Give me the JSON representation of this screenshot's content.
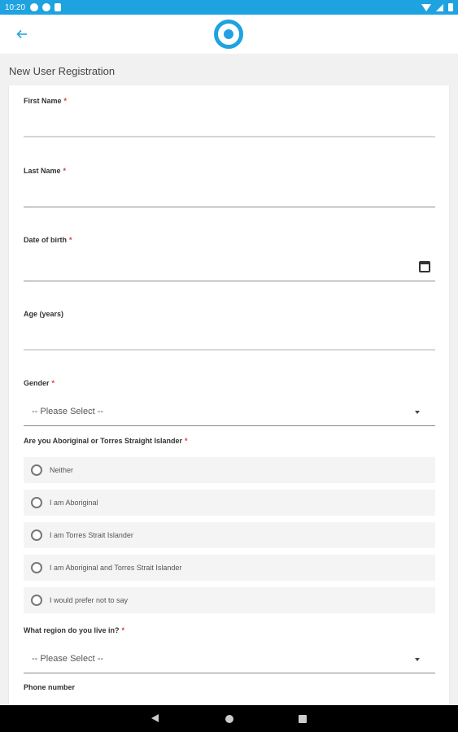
{
  "status_bar": {
    "time": "10:20"
  },
  "page": {
    "title": "New User Registration"
  },
  "form": {
    "first_name": {
      "label": "First Name",
      "required": "*"
    },
    "last_name": {
      "label": "Last Name",
      "required": "*"
    },
    "dob": {
      "label": "Date of birth",
      "required": "*"
    },
    "age": {
      "label": "Age (years)"
    },
    "gender": {
      "label": "Gender",
      "required": "*",
      "value": "-- Please Select --"
    },
    "indigenous": {
      "label": "Are you Aboriginal or Torres Straight Islander",
      "required": "*",
      "options": [
        "Neither",
        "I am Aboriginal",
        "I am Torres Strait Islander",
        "I am Aboriginal and Torres Strait Islander",
        "I would prefer not to say"
      ]
    },
    "region": {
      "label": "What region do you live in?",
      "required": "*",
      "value": "-- Please Select --"
    },
    "phone": {
      "label": "Phone number"
    }
  },
  "icons": {
    "back": "arrow-left-icon",
    "logo": "circle-logo-icon",
    "calendar": "calendar-icon",
    "dropdown": "chevron-down-icon"
  },
  "colors": {
    "accent": "#1ea3e0",
    "required": "#d83b3b"
  }
}
